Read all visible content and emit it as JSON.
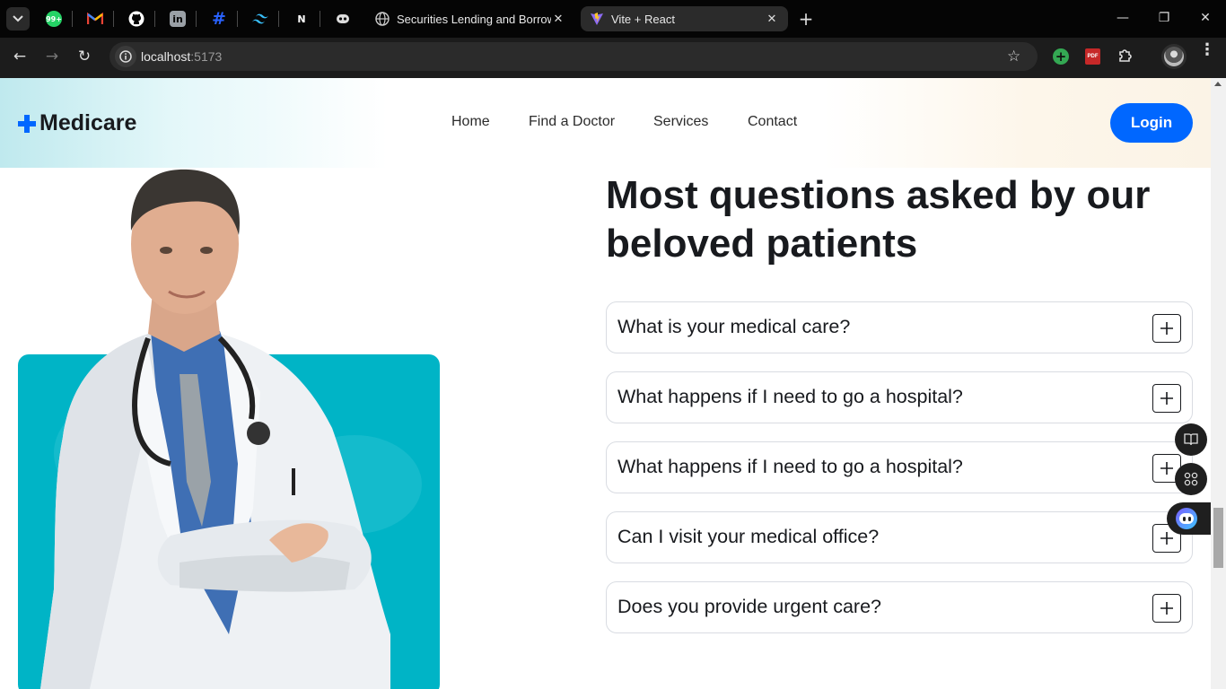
{
  "browser": {
    "pinned_tabs": [
      {
        "icon": "whatsapp-icon",
        "badge": "99+",
        "color": "#25d366"
      },
      {
        "icon": "gmail-icon",
        "color": "#ea4335"
      },
      {
        "icon": "github-icon",
        "color": "#ffffff"
      },
      {
        "icon": "linkedin-icon",
        "color": "#0a66c2"
      },
      {
        "icon": "hashnode-icon",
        "color": "#2962ff"
      },
      {
        "icon": "tailwind-icon",
        "color": "#38bdf8"
      },
      {
        "icon": "nextjs-icon",
        "color": "#ffffff"
      },
      {
        "icon": "chatbot-icon",
        "color": "#ffffff"
      }
    ],
    "tabs": [
      {
        "title": "Securities Lending and Borrowing",
        "icon": "globe-icon",
        "active": false
      },
      {
        "title": "Vite + React",
        "icon": "vite-icon",
        "active": true
      }
    ],
    "url_host": "localhost",
    "url_port": ":5173"
  },
  "header": {
    "logo": "Medicare",
    "nav": [
      "Home",
      "Find a Doctor",
      "Services",
      "Contact"
    ],
    "login_label": "Login"
  },
  "faq": {
    "heading_line1": "Most questions asked by our",
    "heading_line2": "beloved patients",
    "items": [
      "What is your medical care?",
      "What happens if I need to go a hospital?",
      "What happens if I need to go a hospital?",
      "Can I visit your medical office?",
      "Does you provide urgent care?"
    ]
  },
  "colors": {
    "primary": "#0067ff",
    "teal": "#00b4c6",
    "heading": "#181a1e"
  }
}
